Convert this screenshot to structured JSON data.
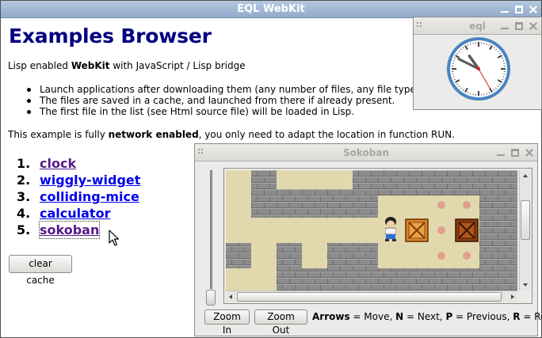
{
  "main_window": {
    "title": "EQL WebKit",
    "heading": "Examples Browser",
    "intro_prefix": "Lisp enabled ",
    "intro_bold": "WebKit",
    "intro_suffix": " with JavaScript / Lisp bridge",
    "bullets": [
      "Launch applications after downloading them (any number of files, any file type).",
      "The files are saved in a cache, and launched from there if already present.",
      "The first file in the list (see Html source file) will be loaded in Lisp."
    ],
    "network_prefix": "This example is fully ",
    "network_bold": "network enabled",
    "network_suffix": ", you only need to adapt the location in function RUN.",
    "apps": [
      {
        "num": "1.",
        "label": "clock"
      },
      {
        "num": "2.",
        "label": "wiggly-widget"
      },
      {
        "num": "3.",
        "label": "colliding-mice"
      },
      {
        "num": "4.",
        "label": "calculator"
      },
      {
        "num": "5.",
        "label": "sokoban"
      }
    ],
    "clear_cache_label": "clear cache"
  },
  "clock_window": {
    "title": "eql",
    "time": {
      "hour": 10,
      "minute": 49,
      "second": 25
    },
    "colors": {
      "rim": "#4a84c0",
      "hands": "#5a5a5a",
      "second_hand": "#d02020"
    }
  },
  "sokoban_window": {
    "title": "Sokoban",
    "zoom_in_label": "Zoom In",
    "zoom_out_label": "Zoom Out",
    "key_arrows": "Arrows",
    "text_move": " = Move, ",
    "key_n": "N",
    "text_next": " = Next, ",
    "key_p": "P",
    "text_previous": " = Previous, ",
    "key_r": "R",
    "text_restart": " = Restart",
    "colors": {
      "floor": "#e2d8ae",
      "wall": "#8c8c8c",
      "goal": "#e0a08e",
      "box": "#d9842a",
      "box_on_goal": "#8a3f12"
    }
  }
}
